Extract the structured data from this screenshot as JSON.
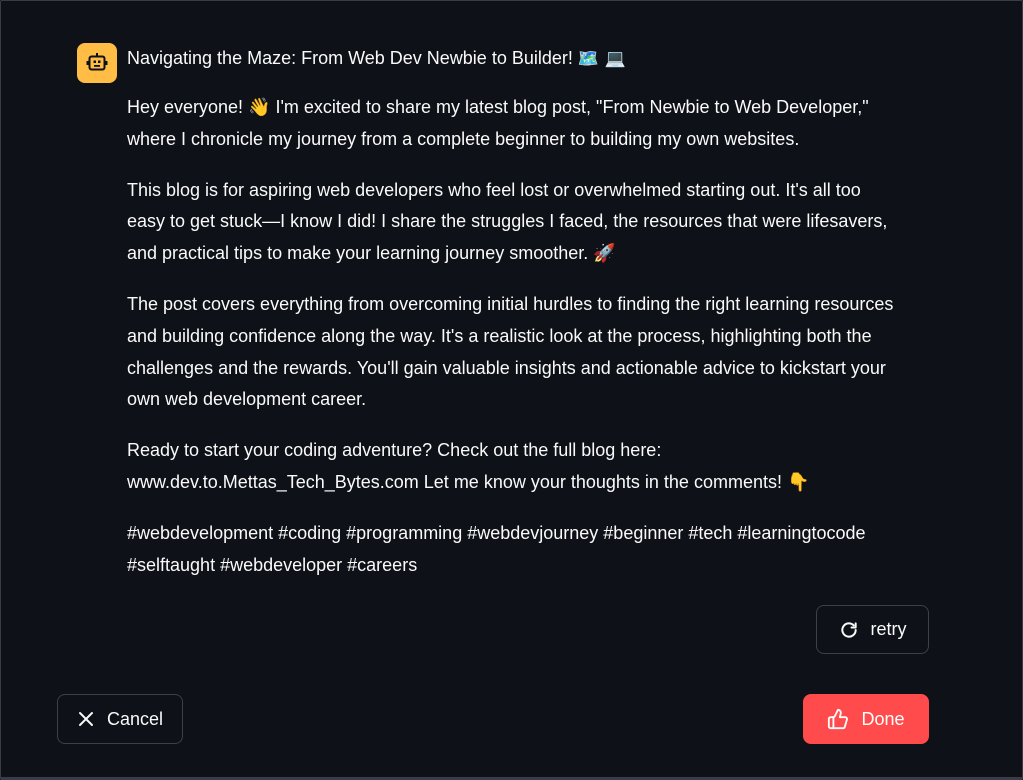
{
  "message": {
    "avatar_icon": "robot-icon",
    "accent_color": "#ffbd45",
    "title": "Navigating the Maze: From Web Dev Newbie to Builder!",
    "title_emojis": "🗺️ 💻",
    "paragraphs": [
      {
        "line1": "Hey everyone! 👋 I'm excited to share my latest blog post, \"From Newbie to Web Developer,\"",
        "line2": "where I chronicle my journey from a complete beginner to building my own websites."
      },
      {
        "line1": "This blog is for aspiring web developers who feel lost or overwhelmed starting out. It's all too",
        "line2": "easy to get stuck—I know I did! I share the struggles I faced, the resources that were lifesavers,",
        "line3": "and practical tips to make your learning journey smoother. 🚀"
      },
      {
        "line1": "The post covers everything from overcoming initial hurdles to finding the right learning resources",
        "line2": "and building confidence along the way. It's a realistic look at the process, highlighting both the",
        "line3": "challenges and the rewards. You'll gain valuable insights and actionable advice to kickstart your",
        "line4": "own web development career."
      },
      {
        "line1": "Ready to start your coding adventure? Check out the full blog here:",
        "line2": "www.dev.to.Mettas_Tech_Bytes.com Let me know your thoughts in the comments! 👇"
      },
      {
        "line1": "#webdevelopment #coding #programming #webdevjourney #beginner #tech #learningtocode",
        "line2": "#selftaught #webdeveloper #careers"
      }
    ]
  },
  "actions": {
    "retry_label": "retry",
    "retry_icon": "refresh-icon",
    "cancel_label": "Cancel",
    "cancel_icon": "close-icon",
    "done_label": "Done",
    "done_icon": "thumbs-up-icon",
    "done_color": "#ff4b4b"
  }
}
